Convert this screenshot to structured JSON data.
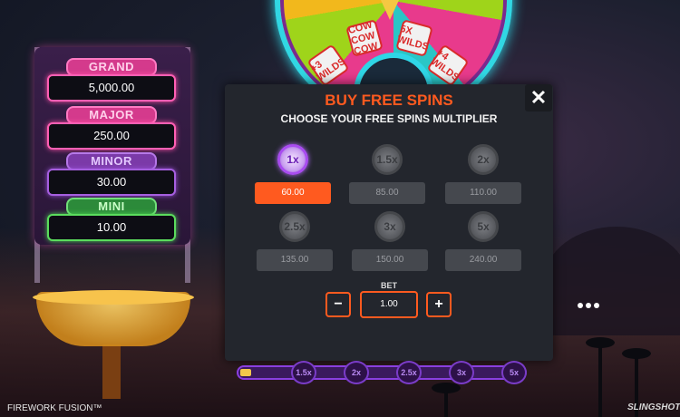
{
  "jackpots": [
    {
      "label": "GRAND",
      "value": "5,000.00"
    },
    {
      "label": "MAJOR",
      "value": "250.00"
    },
    {
      "label": "MINOR",
      "value": "30.00"
    },
    {
      "label": "MINI",
      "value": "10.00"
    }
  ],
  "wheel": {
    "tiles": [
      "+3 WILDS",
      "COW COW COW",
      "5X WILDS",
      "+4 WILDS"
    ]
  },
  "modal": {
    "title": "BUY FREE SPINS",
    "subtitle": "CHOOSE YOUR FREE SPINS MULTIPLIER",
    "options": [
      {
        "multiplier": "1x",
        "price": "60.00",
        "selected": true
      },
      {
        "multiplier": "1.5x",
        "price": "85.00",
        "selected": false
      },
      {
        "multiplier": "2x",
        "price": "110.00",
        "selected": false
      },
      {
        "multiplier": "2.5x",
        "price": "135.00",
        "selected": false
      },
      {
        "multiplier": "3x",
        "price": "150.00",
        "selected": false
      },
      {
        "multiplier": "5x",
        "price": "240.00",
        "selected": false
      }
    ],
    "bet": {
      "label": "BET",
      "value": "1.00",
      "decrease": "−",
      "increase": "+"
    },
    "close": "✕"
  },
  "track": {
    "nodes": [
      "1.5x",
      "2x",
      "2.5x",
      "3x",
      "5x"
    ]
  },
  "footer": {
    "game_name": "FIREWORK FUSION™",
    "brand": "SLINGSHOT"
  },
  "colors": {
    "accent": "#ff5a1f",
    "selected_badge": "#a94cf0"
  }
}
